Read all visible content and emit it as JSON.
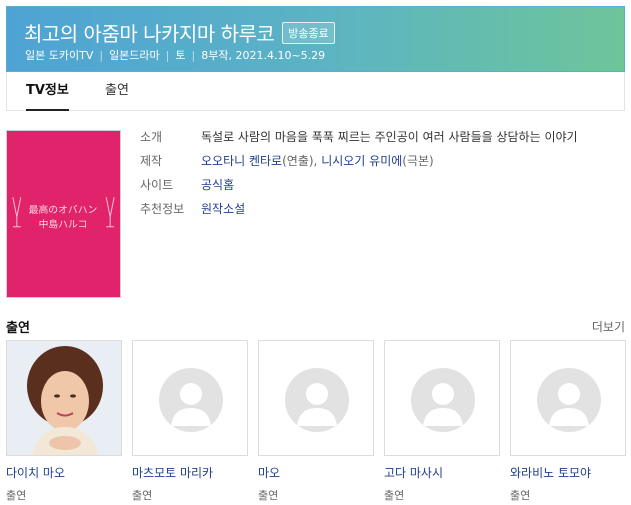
{
  "header": {
    "title": "최고의 아줌마 나카지마 하루코",
    "badge": "방송종료",
    "meta": [
      "일본 도카이TV",
      "일본드라마",
      "토",
      "8부작, 2021.4.10~5.29"
    ]
  },
  "tabs": [
    {
      "label": "TV정보",
      "active": true
    },
    {
      "label": "출연",
      "active": false
    }
  ],
  "poster": {
    "text_line1": "最高のオバハン",
    "text_line2": "中島ハルコ"
  },
  "info": {
    "intro_label": "소개",
    "intro_text": "독설로 사람의 마음을 푹푹 찌르는 주인공이 여러 사람들을 상담하는 이야기",
    "production_label": "제작",
    "director": "오오타니 켄타로",
    "director_role": "(연출), ",
    "writer": "니시오기 유미에",
    "writer_role": "(극본)",
    "site_label": "사이트",
    "site_link": "공식홈",
    "recommend_label": "추천정보",
    "recommend_link": "원작소설"
  },
  "cast_section": {
    "title": "출연",
    "more": "더보기"
  },
  "cast": [
    {
      "name": "다이치 마오",
      "role": "출연"
    },
    {
      "name": "마츠모토 마리카",
      "role": "출연"
    },
    {
      "name": "마오",
      "role": "출연"
    },
    {
      "name": "고다 마사시",
      "role": "출연"
    },
    {
      "name": "와라비노 토모야",
      "role": "출연"
    }
  ]
}
